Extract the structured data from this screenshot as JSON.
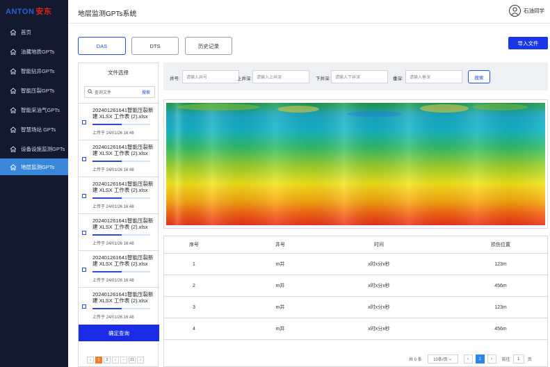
{
  "logo": {
    "en": "ANTON",
    "cn": "安东"
  },
  "app_title": "地层监测GPTs系统",
  "user": {
    "name": "石油同学"
  },
  "sidebar": {
    "items": [
      {
        "label": "首页",
        "active": false
      },
      {
        "label": "油藏地质GPTs",
        "active": false
      },
      {
        "label": "智能钻井GPTs",
        "active": false
      },
      {
        "label": "智能压裂GPTs",
        "active": false
      },
      {
        "label": "智能采油气GPTs",
        "active": false
      },
      {
        "label": "智慧场站 GPTs",
        "active": false
      },
      {
        "label": "设备设施监测GPTs",
        "active": false
      },
      {
        "label": "地层监测GPTs",
        "active": true
      }
    ]
  },
  "tabs": [
    {
      "label": "DAS",
      "active": true
    },
    {
      "label": "DTS",
      "active": false
    },
    {
      "label": "历史记录",
      "active": false
    }
  ],
  "import_label": "导入文件",
  "file_panel": {
    "title": "文件选择",
    "search_placeholder": "查询文件",
    "search_button": "搜索",
    "files": [
      {
        "name": "202401261641智能压裂新建 XLSX 工作表 (2).xlsx",
        "time": "上传于 24/01/26 16:48",
        "progress": 0.5
      },
      {
        "name": "202401261641智能压裂新建 XLSX 工作表 (2).xlsx",
        "time": "上传于 24/01/26 16:48",
        "progress": 0.5
      },
      {
        "name": "202401261641智能压裂新建 XLSX 工作表 (2).xlsx",
        "time": "上传于 24/01/26 16:48",
        "progress": 0.5
      },
      {
        "name": "202401261641智能压裂新建 XLSX 工作表 (2).xlsx",
        "time": "上传于 24/01/26 16:48",
        "progress": 0.5
      },
      {
        "name": "202401261641智能压裂新建 XLSX 工作表 (2).xlsx",
        "time": "上传于 24/01/26 16:48",
        "progress": 0.5
      },
      {
        "name": "202401261641智能压裂新建 XLSX 工作表 (2).xlsx",
        "time": "上传于 24/01/26 16:48",
        "progress": 0.5
      }
    ],
    "confirm_label": "确定查询",
    "pager": {
      "prev": "‹",
      "pages": [
        "1",
        "2",
        "›",
        "···",
        "21",
        "›"
      ]
    }
  },
  "filters": {
    "well_label": "井号:",
    "well_placeholder": "请输入井号",
    "top_label": "上井深:",
    "top_placeholder": "请输入上井深",
    "bottom_label": "下井深:",
    "bottom_placeholder": "请输入下井深",
    "depth_label": "垂深:",
    "depth_placeholder": "请输入垂深",
    "search_label": "搜索"
  },
  "table": {
    "headers": [
      "序号",
      "井号",
      "时间",
      "损伤位置"
    ],
    "rows": [
      [
        "1",
        "m井",
        "x时x分x秒",
        "123m"
      ],
      [
        "2",
        "m井",
        "x时x分x秒",
        "456m"
      ],
      [
        "3",
        "m井",
        "x时x分x秒",
        "123m"
      ],
      [
        "4",
        "m井",
        "x时x分x秒",
        "456m"
      ]
    ],
    "pager": {
      "total": "共 0 条",
      "page_size": "10条/页",
      "prev": "‹",
      "current": "1",
      "next": "›",
      "goto_label": "前往",
      "goto_value": "1",
      "page_unit": "页"
    }
  },
  "colors": {
    "sidebar_bg": "#131a2f",
    "active_nav": "#3a86d9",
    "primary": "#1a36e6"
  },
  "icons": {
    "nav": "home-icon",
    "search": "search-icon",
    "user": "user-avatar-icon"
  }
}
